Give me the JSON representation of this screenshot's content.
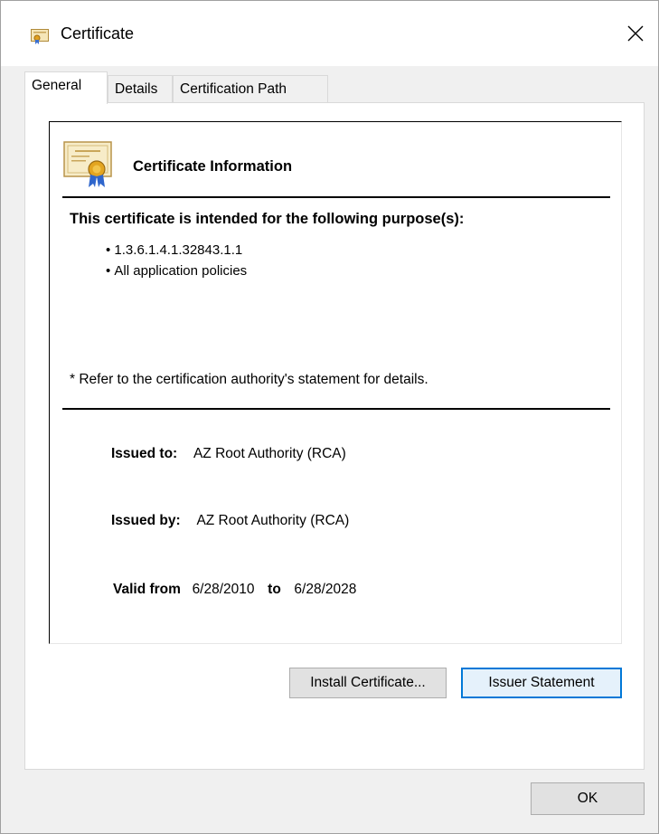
{
  "window": {
    "title": "Certificate",
    "icon": "certificate-icon",
    "close_icon": "close-icon"
  },
  "tabs": [
    {
      "label": "General",
      "active": true
    },
    {
      "label": "Details",
      "active": false
    },
    {
      "label": "Certification Path",
      "active": false
    }
  ],
  "info": {
    "title": "Certificate Information",
    "purpose_heading": "This certificate is intended for the following purpose(s):",
    "purposes": [
      "1.3.6.1.4.1.32843.1.1",
      "All application policies"
    ],
    "note": "* Refer to the certification authority's statement for details."
  },
  "fields": {
    "issued_to_label": "Issued to:",
    "issued_to_value": "AZ Root Authority (RCA)",
    "issued_by_label": "Issued by:",
    "issued_by_value": "AZ Root Authority (RCA)",
    "valid_from_label": "Valid from",
    "valid_from_value": "6/28/2010",
    "valid_to_label": "to",
    "valid_to_value": "6/28/2028"
  },
  "buttons": {
    "install": "Install Certificate...",
    "issuer_statement": "Issuer Statement",
    "ok": "OK"
  },
  "colors": {
    "focus_border": "#0078d7",
    "dialog_bg": "#f0f0f0",
    "panel_bg": "#ffffff"
  }
}
